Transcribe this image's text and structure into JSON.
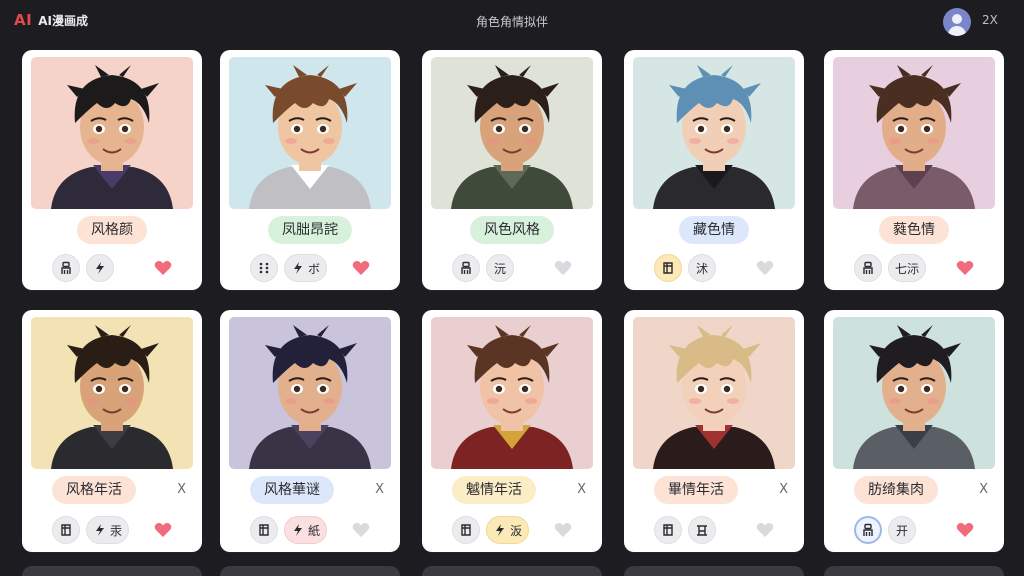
{
  "app": {
    "logo_mark": "AI",
    "logo_text": "AI漫画成",
    "page_title": "角色角情拟伴",
    "zoom": "2X"
  },
  "colors": {
    "accent": "#e2484f",
    "background": "#1d1d21",
    "heart_on": "#f06b7b",
    "heart_off": "#d9d9de"
  },
  "cards": [
    {
      "name": "风格颜",
      "pill_color": "#fde3d6",
      "actions": [
        {
          "icon": "figure-icon"
        },
        {
          "icon": "bolt-icon"
        }
      ],
      "liked": true,
      "closable": false,
      "bg": "#f6d3c9",
      "hair": "#1d1a1c",
      "skin": "#e6b58f",
      "cloth": "#2f2a3a",
      "collar": "#4a3b6b"
    },
    {
      "name": "凤朏昂詫",
      "pill_color": "#d8f1dd",
      "actions": [
        {
          "icon": "grid-icon"
        },
        {
          "icon": "bolt-icon",
          "label": "ボ"
        }
      ],
      "liked": true,
      "closable": false,
      "bg": "#cfe7ec",
      "hair": "#7a4a2c",
      "skin": "#f0c6a2",
      "cloth": "#bfbfc4",
      "collar": "#ffffff"
    },
    {
      "name": "风色风格",
      "pill_color": "#d8f1dd",
      "actions": [
        {
          "icon": "figure-icon"
        },
        {
          "label": "沅"
        }
      ],
      "liked": false,
      "closable": false,
      "bg": "#dfe2d6",
      "hair": "#2a2019",
      "skin": "#d8a27b",
      "cloth": "#3f4a3b",
      "collar": "#5d6a55"
    },
    {
      "name": "藏色情",
      "pill_color": "#dde7fb",
      "actions": [
        {
          "icon": "doc-icon",
          "style": "yellow"
        },
        {
          "label": "沭"
        }
      ],
      "liked": false,
      "closable": false,
      "bg": "#d6e6e4",
      "hair": "#5e8fb5",
      "skin": "#f1cfb6",
      "cloth": "#2a2a2e",
      "collar": "#1a1a1d"
    },
    {
      "name": "蕤色情",
      "pill_color": "#fde3d6",
      "actions": [
        {
          "icon": "figure-icon"
        },
        {
          "label": "七沶"
        }
      ],
      "liked": true,
      "closable": false,
      "bg": "#e7cfe0",
      "hair": "#4a2e22",
      "skin": "#e2ad89",
      "cloth": "#7a5b6a",
      "collar": "#5c4150"
    },
    {
      "name": "风格年活",
      "pill_color": "#fde3d6",
      "actions": [
        {
          "icon": "doc-icon"
        },
        {
          "icon": "bolt-icon",
          "label": "汞"
        }
      ],
      "liked": true,
      "closable": true,
      "bg": "#f3e2b4",
      "hair": "#2a1d15",
      "skin": "#d9a37a",
      "cloth": "#2b2a2e",
      "collar": "#3d3c42"
    },
    {
      "name": "风格華谜",
      "pill_color": "#dde7fb",
      "actions": [
        {
          "icon": "doc-icon"
        },
        {
          "icon": "bolt-icon",
          "label": "紙",
          "style": "pink"
        }
      ],
      "liked": false,
      "closable": true,
      "bg": "#c9c4dc",
      "hair": "#23213a",
      "skin": "#e3b08e",
      "cloth": "#3a3346",
      "collar": "#4b4260"
    },
    {
      "name": "魆情年活",
      "pill_color": "#fbeec6",
      "actions": [
        {
          "icon": "doc-icon"
        },
        {
          "icon": "bolt-icon",
          "label": "汳",
          "style": "yellow"
        }
      ],
      "liked": false,
      "closable": true,
      "bg": "#e9cfcf",
      "hair": "#5a3524",
      "skin": "#f0c2a6",
      "cloth": "#7d2323",
      "collar": "#d4a43a"
    },
    {
      "name": "畢情年活",
      "pill_color": "#fde3d6",
      "actions": [
        {
          "icon": "doc-icon"
        },
        {
          "icon": "doc2-icon"
        }
      ],
      "liked": false,
      "closable": true,
      "bg": "#efd6c9",
      "hair": "#d8bb86",
      "skin": "#f3d0b9",
      "cloth": "#2b1c1c",
      "collar": "#a13131"
    },
    {
      "name": "肪绮集肉",
      "pill_color": "#fde3d6",
      "actions": [
        {
          "icon": "figure-icon",
          "style": "blue-ring"
        },
        {
          "label": "开"
        }
      ],
      "liked": true,
      "closable": true,
      "bg": "#cde2dc",
      "hair": "#1f1d22",
      "skin": "#e3b08e",
      "cloth": "#5a5f66",
      "collar": "#3a3f45"
    }
  ]
}
